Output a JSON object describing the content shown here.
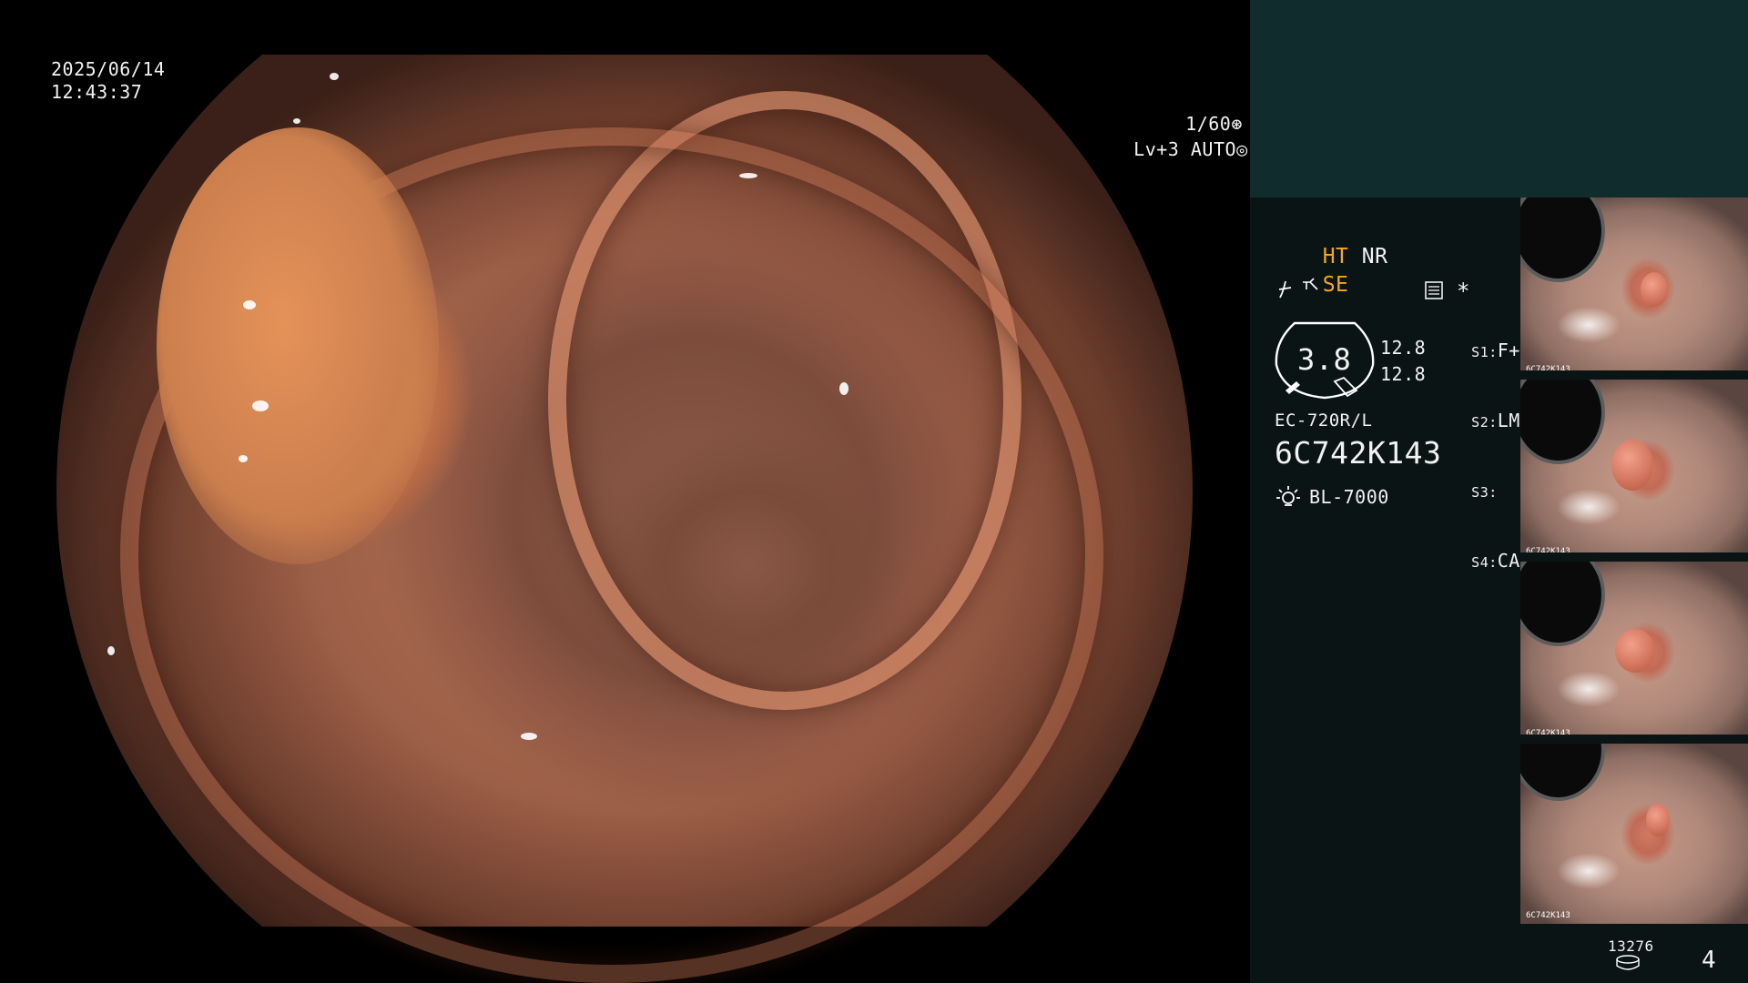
{
  "overlay": {
    "date": "2025/06/14",
    "time": "12:43:37",
    "shutter": "1/60",
    "shutter_icon": "⊛",
    "level": "Lv+3",
    "exposure_mode": "AUTO",
    "exposure_icon": "◎"
  },
  "panel": {
    "mode_ht": "HT",
    "mode_nr": "NR",
    "se_label": "SE",
    "se_icon": "scissors-wave-icon",
    "curve_icon": "f-curve-icon",
    "doc_icon": "settings-card-icon",
    "asterisk": "*",
    "gauge_value": "3.8",
    "gauge_side_top": "12.8",
    "gauge_side_bottom": "12.8",
    "switches": [
      {
        "key": "S1:",
        "value": "F+T"
      },
      {
        "key": "S2:",
        "value": "LM"
      },
      {
        "key": "S3:",
        "value": ""
      },
      {
        "key": "S4:",
        "value": "CAD"
      }
    ],
    "scope_model": "EC-720R/L",
    "serial": "6C742K143",
    "light_source": "BL-7000",
    "light_icon": "lamp-icon",
    "counter": "13276",
    "counter_icon": "disk-icon",
    "page": "4"
  },
  "thumbnails": [
    {
      "label": "6C742K143"
    },
    {
      "label": "6C742K143"
    },
    {
      "label": "6C742K143"
    },
    {
      "label": "6C742K143"
    }
  ],
  "colors": {
    "accent": "#f5a623",
    "panel_bg": "#0b1414",
    "panel_top": "#102c2c"
  }
}
